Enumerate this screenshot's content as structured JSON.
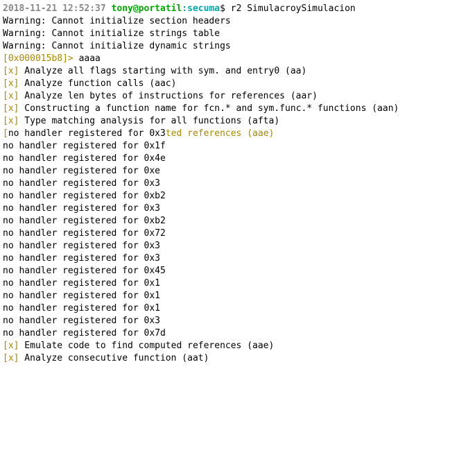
{
  "prompt": {
    "timestamp": "2018-11-21 12:52:37",
    "userhost": "tony@portatil",
    "sep": ":",
    "dir": "secuma",
    "symbol": "$ ",
    "command": "r2 SimulacroySimulacion"
  },
  "warnings": [
    "Warning: Cannot initialize section headers",
    "Warning: Cannot initialize strings table",
    "Warning: Cannot initialize dynamic strings"
  ],
  "r2": {
    "prompt": "[0x000015b8]> ",
    "command": "aaaa"
  },
  "analysis": [
    {
      "marker": "[x]",
      "text": " Analyze all flags starting with sym. and entry0 (aa)"
    },
    {
      "marker": "[x]",
      "text": " Analyze function calls (aac)"
    },
    {
      "marker": "[x]",
      "text": " Analyze len bytes of instructions for references (aar)"
    },
    {
      "marker": "[x]",
      "text": " Constructing a function name for fcn.* and sym.func.* functions (aan)"
    },
    {
      "marker": "[x]",
      "text": " Type matching analysis for all functions (afta)"
    }
  ],
  "mixed": {
    "marker": "[",
    "text1": "no handler registered for 0x3",
    "text2": "ted references (aae)"
  },
  "handlers": [
    "no handler registered for 0x1f",
    "no handler registered for 0x4e",
    "no handler registered for 0xe",
    "no handler registered for 0x3",
    "no handler registered for 0xb2",
    "no handler registered for 0x3",
    "no handler registered for 0xb2",
    "no handler registered for 0x72",
    "no handler registered for 0x3",
    "no handler registered for 0x3",
    "no handler registered for 0x45",
    "no handler registered for 0x1",
    "no handler registered for 0x1",
    "no handler registered for 0x1",
    "no handler registered for 0x3",
    "no handler registered for 0x7d"
  ],
  "analysis2": [
    {
      "marker": "[x]",
      "text": " Emulate code to find computed references (aae)"
    },
    {
      "marker": "[x]",
      "text": " Analyze consecutive function (aat)"
    }
  ]
}
